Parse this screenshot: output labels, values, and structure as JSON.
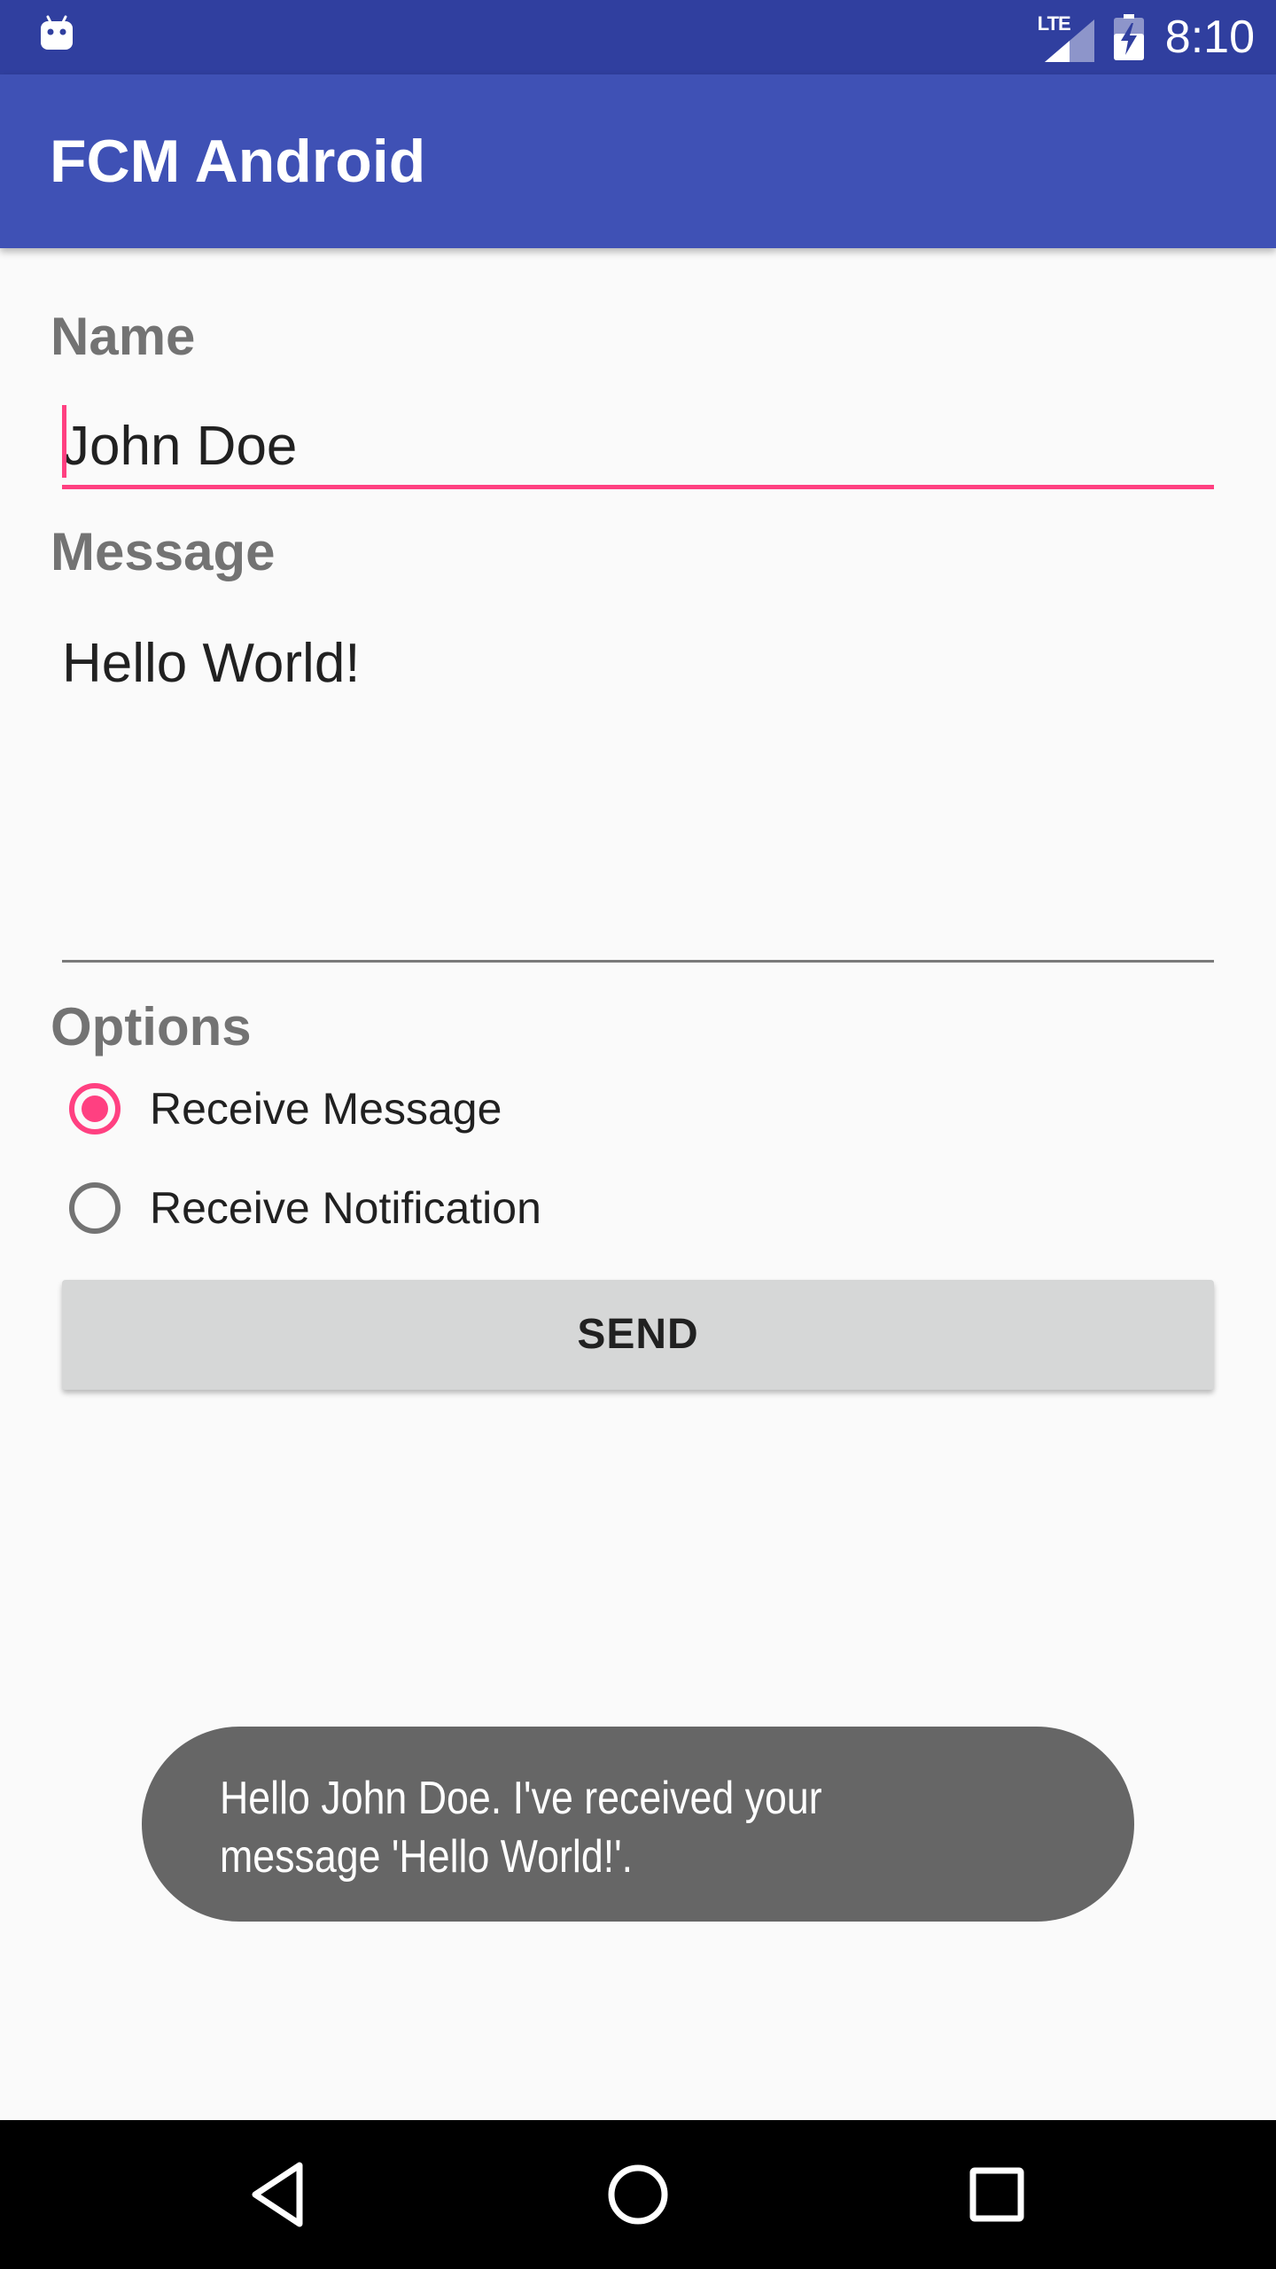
{
  "status_bar": {
    "time": "8:10",
    "network": "LTE",
    "icons": [
      "android-icon",
      "lte-signal-icon",
      "battery-charging-icon"
    ]
  },
  "app_bar": {
    "title": "FCM Android"
  },
  "form": {
    "name_label": "Name",
    "name_value": "John Doe",
    "message_label": "Message",
    "message_value": "Hello World!",
    "options_label": "Options",
    "options": [
      {
        "label": "Receive Message",
        "checked": true
      },
      {
        "label": "Receive Notification",
        "checked": false
      }
    ],
    "send_label": "SEND"
  },
  "toast": {
    "line1": "Hello John Doe. I've received your",
    "line2": "message 'Hello World!'."
  },
  "colors": {
    "status_bar": "#303f9f",
    "app_bar": "#3f51b5",
    "accent": "#ff4081",
    "background": "#fafafa",
    "button": "#d6d7d7",
    "toast": "#666666"
  },
  "nav_bar": {
    "icons": [
      "back-icon",
      "home-icon",
      "recents-icon"
    ]
  }
}
